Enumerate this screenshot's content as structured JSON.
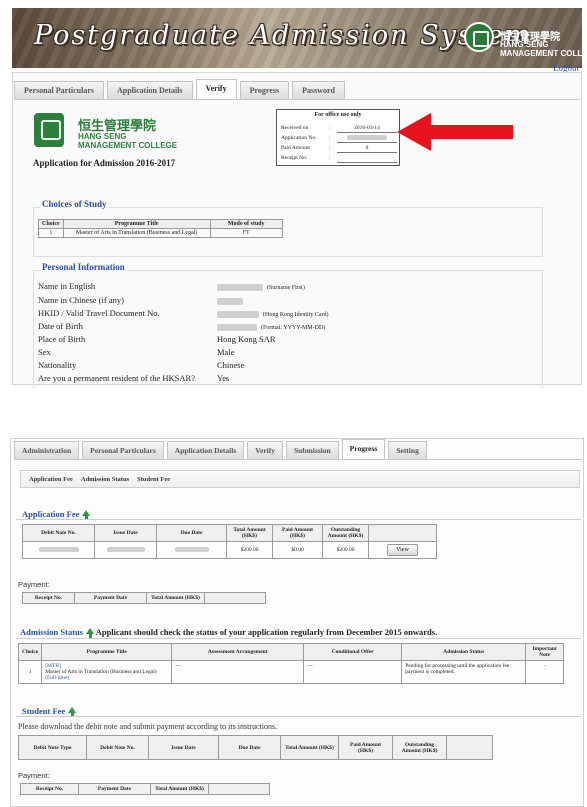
{
  "top": {
    "banner_title": "Postgraduate Admission System",
    "college_zh": "恒生管理學院",
    "college_en_line1": "HANG SENG",
    "college_en_line2": "MANAGEMENT COLLEGE",
    "logout": "Logout",
    "tabs": [
      "Personal Particulars",
      "Application Details",
      "Verify",
      "Progress",
      "Password"
    ],
    "active_tab": "Verify",
    "app_heading": "Application for Admission 2016-2017",
    "office": {
      "title": "For office use only",
      "rows": [
        {
          "label": "Received on",
          "value": "2016-03-14"
        },
        {
          "label": "Application No.",
          "value": ""
        },
        {
          "label": "Paid Amount",
          "value": "0"
        },
        {
          "label": "Receipt No.",
          "value": ""
        }
      ]
    },
    "arrow_color": "#e8141b",
    "choices": {
      "title": "Choices of Study",
      "headers": [
        "Choice",
        "Programme Title",
        "Mode of study"
      ],
      "rows": [
        [
          "1",
          "Master of Arts in Translation (Business and Legal)",
          "FT"
        ]
      ]
    },
    "personal": {
      "title": "Personal Information",
      "rows": [
        {
          "label": "Name in English",
          "value": "",
          "note": "(Surname First)"
        },
        {
          "label": "Name in Chinese (if any)",
          "value": "",
          "note": ""
        },
        {
          "label": "HKID / Valid Travel Document No.",
          "value": "",
          "note": "(Hong Kong Identity Card)"
        },
        {
          "label": "Date of Birth",
          "value": "",
          "note": "(Format: YYYY-MM-DD)"
        },
        {
          "label": "Place of Birth",
          "value": "Hong Kong SAR",
          "note": ""
        },
        {
          "label": "Sex",
          "value": "Male",
          "note": ""
        },
        {
          "label": "Nationality",
          "value": "Chinese",
          "note": ""
        },
        {
          "label": "Are you a permanent resident of the HKSAR?",
          "value": "Yes",
          "note": ""
        }
      ]
    }
  },
  "bottom": {
    "tabs": [
      "Administration",
      "Personal Particulars",
      "Application Details",
      "Verify",
      "Submission",
      "Progress",
      "Setting"
    ],
    "active_tab": "Progress",
    "sub_tabs": [
      "Application Fee",
      "Admission Status",
      "Student Fee"
    ],
    "application_fee": {
      "title": "Application Fee",
      "headers": [
        "Debit Note No.",
        "Issue Date",
        "Due Date",
        "Total Amount (HK$)",
        "Paid Amount (HK$)",
        "Outstanding Amount (HK$)",
        ""
      ],
      "row": {
        "total": "$200.00",
        "paid": "$0.00",
        "outstanding": "$200.00",
        "action": "View"
      }
    },
    "payment_label": "Payment:",
    "payment_headers": [
      "Receipt No.",
      "Payment Date",
      "Total Amount (HK$)",
      ""
    ],
    "admission_status": {
      "title": "Admission Status",
      "notice": "Applicant should check the status of your application regularly from December 2015 onwards.",
      "headers": [
        "Choice",
        "Programme Title",
        "Assessment Arrangement",
        "Conditional Offer",
        "Admission Status",
        "Important Note"
      ],
      "row": {
        "choice": "1",
        "code": "[MTB]",
        "programme": "Master of Arts in Translation (Business and Legal)",
        "mode": "(Full-time)",
        "assessment": "---",
        "offer": "---",
        "status": "Pending for processing until the application fee payment is completed.",
        "note": "-"
      }
    },
    "student_fee": {
      "title": "Student Fee",
      "instruction": "Please download the debit note and submit payment according to its instructions.",
      "headers": [
        "Debit Note Type",
        "Debit Note No.",
        "Issue Date",
        "Due Date",
        "Total Amount (HK$)",
        "Paid Amount (HK$)",
        "Outstanding Amount (HK$)",
        ""
      ]
    }
  }
}
